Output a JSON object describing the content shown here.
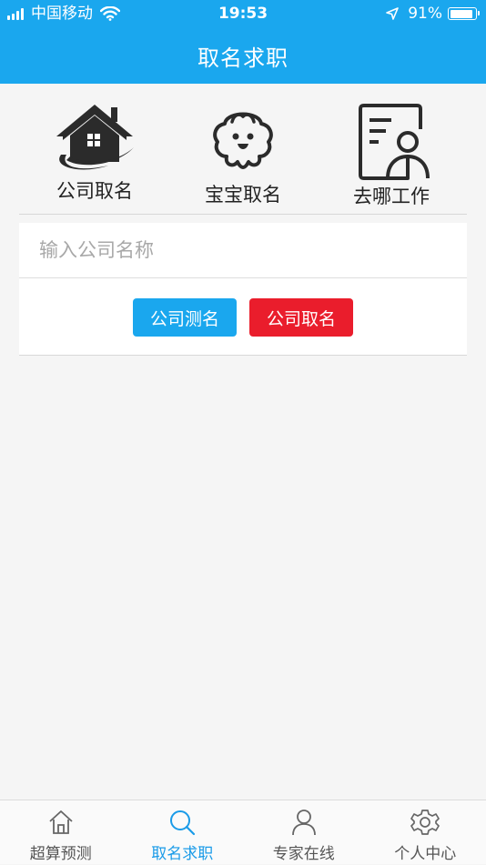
{
  "status_bar": {
    "carrier": "中国移动",
    "time": "19:53",
    "battery_pct": "91%",
    "battery_level": 0.91
  },
  "header": {
    "title": "取名求职"
  },
  "categories": [
    {
      "label": "公司取名",
      "icon": "house-icon"
    },
    {
      "label": "宝宝取名",
      "icon": "baby-face-icon"
    },
    {
      "label": "去哪工作",
      "icon": "resume-icon"
    }
  ],
  "form": {
    "company_input": {
      "placeholder": "输入公司名称",
      "value": ""
    },
    "test_button": "公司测名",
    "name_button": "公司取名"
  },
  "colors": {
    "accent": "#1aa7ee",
    "danger": "#ea1d2c",
    "tab_active": "#1a9be8"
  },
  "tabbar": {
    "tabs": [
      {
        "label": "超算预测",
        "icon": "home-icon",
        "active": false
      },
      {
        "label": "取名求职",
        "icon": "search-icon",
        "active": true
      },
      {
        "label": "专家在线",
        "icon": "person-icon",
        "active": false
      },
      {
        "label": "个人中心",
        "icon": "gear-icon",
        "active": false
      }
    ]
  }
}
